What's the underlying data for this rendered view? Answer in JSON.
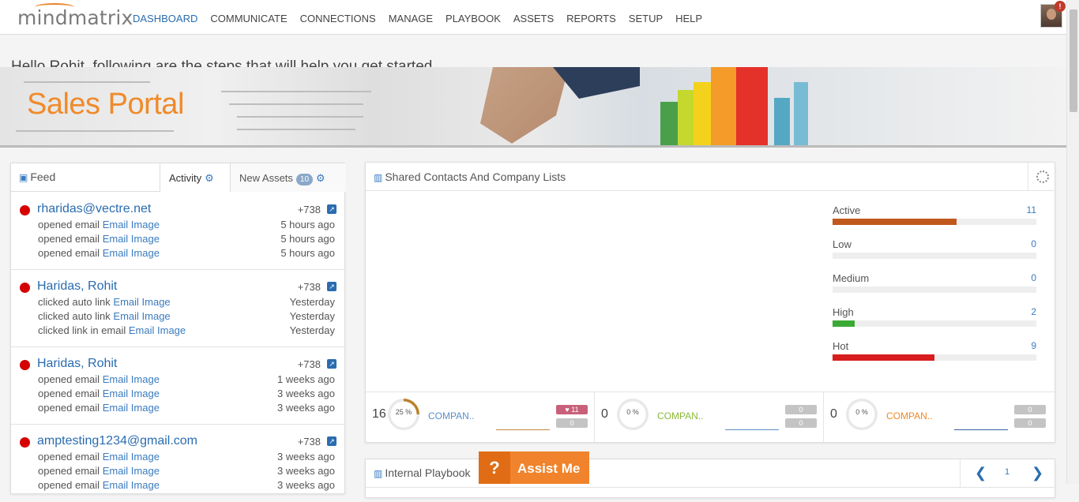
{
  "header": {
    "logo": "mindmatrix",
    "nav": [
      "DASHBOARD",
      "COMMUNICATE",
      "CONNECTIONS",
      "MANAGE",
      "PLAYBOOK",
      "ASSETS",
      "REPORTS",
      "SETUP",
      "HELP"
    ],
    "active_nav": "DASHBOARD",
    "notification_badge": "!"
  },
  "greeting": "Hello Rohit, following are the steps that will help you get started",
  "banner": {
    "title": "Sales Portal"
  },
  "feed": {
    "title": "Feed",
    "tab_activity": "Activity",
    "tab_new_assets": "New Assets",
    "new_assets_count": "10",
    "items": [
      {
        "name": "rharidas@vectre.net",
        "score": "+738",
        "rows": [
          {
            "action": "opened email",
            "asset": "Email Image",
            "time": "5 hours ago"
          },
          {
            "action": "opened email",
            "asset": "Email Image",
            "time": "5 hours ago"
          },
          {
            "action": "opened email",
            "asset": "Email Image",
            "time": "5 hours ago"
          }
        ]
      },
      {
        "name": "Haridas, Rohit",
        "score": "+738",
        "rows": [
          {
            "action": "clicked auto link",
            "asset": "Email Image",
            "time": "Yesterday"
          },
          {
            "action": "clicked auto link",
            "asset": "Email Image",
            "time": "Yesterday"
          },
          {
            "action": "clicked link in email",
            "asset": "Email Image",
            "time": "Yesterday"
          }
        ]
      },
      {
        "name": "Haridas, Rohit",
        "score": "+738",
        "rows": [
          {
            "action": "opened email",
            "asset": "Email Image",
            "time": "1 weeks ago"
          },
          {
            "action": "opened email",
            "asset": "Email Image",
            "time": "3 weeks ago"
          },
          {
            "action": "opened email",
            "asset": "Email Image",
            "time": "3 weeks ago"
          }
        ]
      },
      {
        "name": "amptesting1234@gmail.com",
        "score": "+738",
        "rows": [
          {
            "action": "opened email",
            "asset": "Email Image",
            "time": "3 weeks ago"
          },
          {
            "action": "opened email",
            "asset": "Email Image",
            "time": "3 weeks ago"
          },
          {
            "action": "opened email",
            "asset": "Email Image",
            "time": "3 weeks ago"
          }
        ]
      }
    ]
  },
  "shared": {
    "title": "Shared Contacts And Company Lists",
    "bars": [
      {
        "label": "Active",
        "value": "11",
        "fill": 0.61,
        "color": "#c0581e"
      },
      {
        "label": "Low",
        "value": "0",
        "fill": 0,
        "color": "#3a7bbf"
      },
      {
        "label": "Medium",
        "value": "0",
        "fill": 0,
        "color": "#3a7bbf"
      },
      {
        "label": "High",
        "value": "2",
        "fill": 0.11,
        "color": "#3aaa35"
      },
      {
        "label": "Hot",
        "value": "9",
        "fill": 0.5,
        "color": "#d71d1d"
      }
    ],
    "stats": [
      {
        "count": "16",
        "percent": "25 %",
        "label": "COMPAN..",
        "label_color": "#5a8fc7",
        "ring_fill": 0.25,
        "ring_color": "#b9802b",
        "pill1": "♥ 11",
        "pill1_color": "#c9607a",
        "pill2": "0",
        "line_color": "#c08a3e"
      },
      {
        "count": "0",
        "percent": "0 %",
        "label": "COMPAN..",
        "label_color": "#8cb83a",
        "ring_fill": 0,
        "ring_color": "#e8e8e8",
        "pill1": "0",
        "pill1_color": "#c4c4c4",
        "pill2": "0",
        "line_color": "#5a8fc7"
      },
      {
        "count": "0",
        "percent": "0 %",
        "label": "COMPAN..",
        "label_color": "#ef8a25",
        "ring_fill": 0,
        "ring_color": "#e8e8e8",
        "pill1": "0",
        "pill1_color": "#c4c4c4",
        "pill2": "0",
        "line_color": "#3a5fa0"
      }
    ]
  },
  "playbook": {
    "title": "Internal Playbook",
    "page": "1"
  },
  "assist": {
    "icon": "?",
    "label": "Assist Me"
  }
}
